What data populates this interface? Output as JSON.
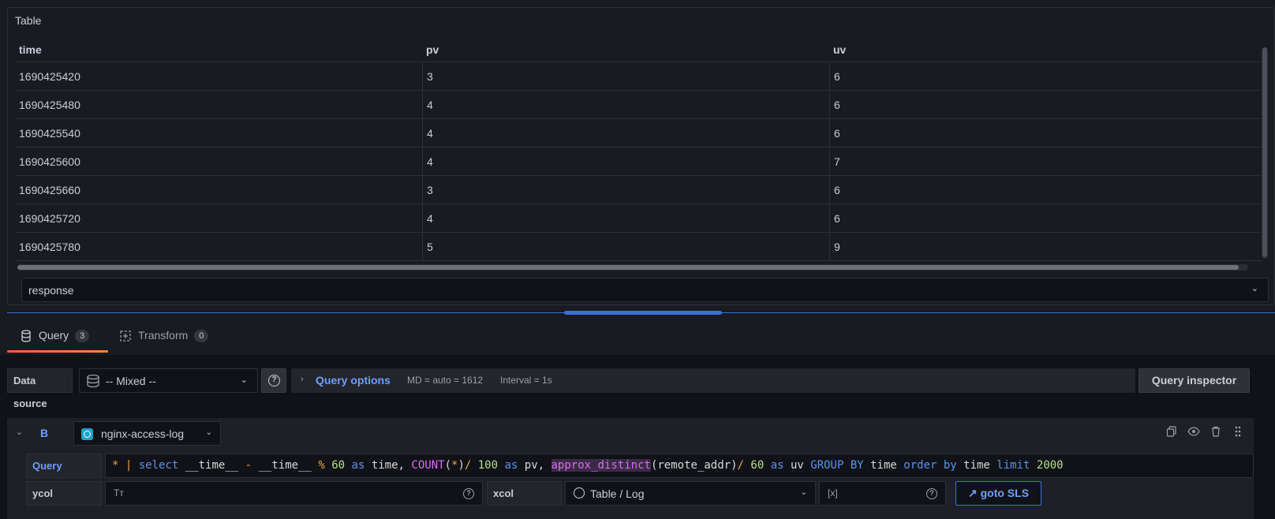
{
  "panel": {
    "title": "Table",
    "columns": [
      "time",
      "pv",
      "uv"
    ],
    "rows": [
      [
        "1690425420",
        "3",
        "6"
      ],
      [
        "1690425480",
        "4",
        "6"
      ],
      [
        "1690425540",
        "4",
        "6"
      ],
      [
        "1690425600",
        "4",
        "7"
      ],
      [
        "1690425660",
        "3",
        "6"
      ],
      [
        "1690425720",
        "4",
        "6"
      ],
      [
        "1690425780",
        "5",
        "9"
      ]
    ],
    "frame_select": "response"
  },
  "tabs": [
    {
      "label": "Query",
      "count": "3",
      "icon": "database-icon"
    },
    {
      "label": "Transform",
      "count": "0",
      "icon": "transform-icon"
    }
  ],
  "datasource": {
    "label": "Data source",
    "value": "-- Mixed --",
    "query_options_label": "Query options",
    "md": "MD = auto = 1612",
    "interval": "Interval = 1s",
    "inspector_label": "Query inspector"
  },
  "query_row": {
    "ref_id": "B",
    "datasource": "nginx-access-log",
    "query_label": "Query",
    "query_text": "* | select __time__ - __time__ % 60 as time, COUNT(*)/ 100 as pv, approx_distinct(remote_addr)/ 60 as uv GROUP BY time order by time limit 2000",
    "ycol_label": "ycol",
    "ycol_prefix": "Tт",
    "xcol_label": "xcol",
    "xcol_value": "Table / Log",
    "extra_prefix": "[x]",
    "goto_label": "goto SLS"
  },
  "colors": {
    "accent": "#6e9fff",
    "tab_underline": "#ff7a3d",
    "background": "#181b1f"
  }
}
